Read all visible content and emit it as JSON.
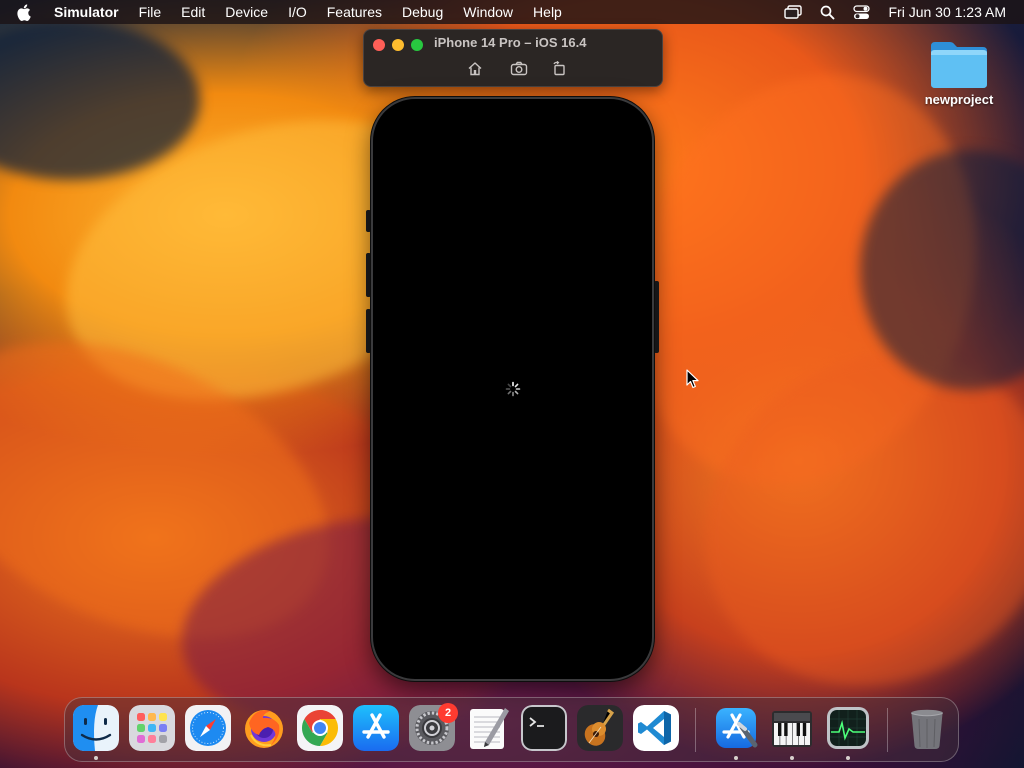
{
  "menubar": {
    "app_name": "Simulator",
    "items": [
      "File",
      "Edit",
      "Device",
      "I/O",
      "Features",
      "Debug",
      "Window",
      "Help"
    ],
    "clock": "Fri Jun 30  1:23 AM",
    "status_icons": [
      "screen-mirroring-icon",
      "spotlight-search-icon",
      "control-center-icon"
    ]
  },
  "simulator": {
    "title": "iPhone 14 Pro – iOS 16.4",
    "toolbar_icons": [
      "home-icon",
      "screenshot-icon",
      "rotate-icon"
    ],
    "screen_state": "loading"
  },
  "desktop": {
    "folder_label": "newproject"
  },
  "dock": {
    "apps": [
      {
        "name": "Finder",
        "icon": "finder-icon",
        "running": true
      },
      {
        "name": "Launchpad",
        "icon": "launchpad-icon",
        "running": false
      },
      {
        "name": "Safari",
        "icon": "safari-icon",
        "running": false
      },
      {
        "name": "Firefox",
        "icon": "firefox-icon",
        "running": false
      },
      {
        "name": "Google Chrome",
        "icon": "chrome-icon",
        "running": false
      },
      {
        "name": "App Store",
        "icon": "app-store-icon",
        "running": false
      },
      {
        "name": "System Settings",
        "icon": "system-settings-icon",
        "running": false,
        "badge": "2"
      },
      {
        "name": "TextEdit",
        "icon": "textedit-icon",
        "running": false
      },
      {
        "name": "Terminal",
        "icon": "terminal-icon",
        "running": false
      },
      {
        "name": "GarageBand",
        "icon": "garageband-icon",
        "running": false
      },
      {
        "name": "Visual Studio Code",
        "icon": "vscode-icon",
        "running": false
      },
      {
        "name": "Xcode",
        "icon": "xcode-icon",
        "running": true
      },
      {
        "name": "Audio MIDI Setup",
        "icon": "piano-icon",
        "running": true
      },
      {
        "name": "Activity Monitor",
        "icon": "activity-monitor-icon",
        "running": true
      },
      {
        "name": "Trash",
        "icon": "trash-icon",
        "running": false
      }
    ]
  },
  "colors": {
    "close": "#ff5f57",
    "minimize": "#febc2e",
    "maximize": "#28c840",
    "badge": "#ff3b30"
  }
}
